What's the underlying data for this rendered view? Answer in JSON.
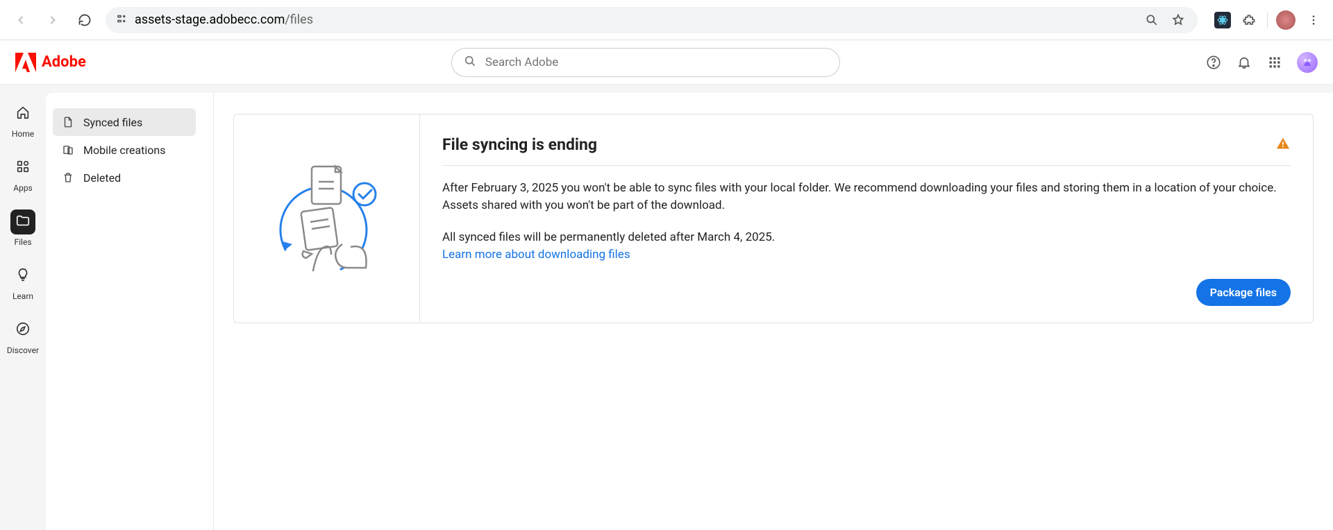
{
  "browser": {
    "url_host": "assets-stage.adobecc.com",
    "url_path": "/files"
  },
  "header": {
    "brand": "Adobe",
    "search_placeholder": "Search Adobe"
  },
  "rail": {
    "items": [
      {
        "label": "Home",
        "icon": "home-icon"
      },
      {
        "label": "Apps",
        "icon": "apps-icon"
      },
      {
        "label": "Files",
        "icon": "folder-icon"
      },
      {
        "label": "Learn",
        "icon": "lightbulb-icon"
      },
      {
        "label": "Discover",
        "icon": "compass-icon"
      }
    ],
    "active": "Files"
  },
  "sidebar": {
    "items": [
      {
        "label": "Synced files",
        "icon": "file-icon"
      },
      {
        "label": "Mobile creations",
        "icon": "devices-icon"
      },
      {
        "label": "Deleted",
        "icon": "trash-icon"
      }
    ],
    "active": "Synced files"
  },
  "banner": {
    "title": "File syncing is ending",
    "p1": "After February 3, 2025 you won't be able to sync files with your local folder. We recommend downloading your files and storing them in a location of your choice. Assets shared with you won't be part of the download.",
    "p2": "All synced files will be permanently deleted after March 4, 2025.",
    "link_text": "Learn more about downloading files",
    "button": "Package files"
  }
}
